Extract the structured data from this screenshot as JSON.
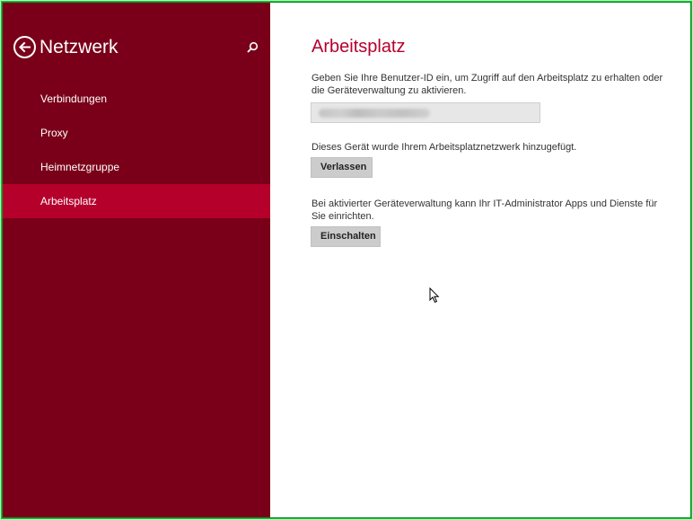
{
  "sidebar": {
    "title": "Netzwerk",
    "items": [
      {
        "label": "Verbindungen",
        "active": false
      },
      {
        "label": "Proxy",
        "active": false
      },
      {
        "label": "Heimnetzgruppe",
        "active": false
      },
      {
        "label": "Arbeitsplatz",
        "active": true
      }
    ],
    "icons": {
      "back": "back-arrow-icon",
      "search": "search-icon"
    }
  },
  "main": {
    "title": "Arbeitsplatz",
    "userid_description": "Geben Sie Ihre Benutzer-ID ein, um Zugriff auf den Arbeitsplatz zu erhalten oder die Geräteverwaltung zu aktivieren.",
    "device_status": "Dieses Gerät wurde Ihrem Arbeitsplatznetzwerk hinzugefügt.",
    "leave_button": "Verlassen",
    "management_description": "Bei aktivierter Geräteverwaltung kann Ihr IT-Administrator Apps und Dienste für Sie einrichten.",
    "enable_button": "Einschalten"
  },
  "colors": {
    "sidebar_bg": "#7a0019",
    "active_item_bg": "#b5002c",
    "accent_title": "#b5002c",
    "frame_border": "#19c234"
  }
}
